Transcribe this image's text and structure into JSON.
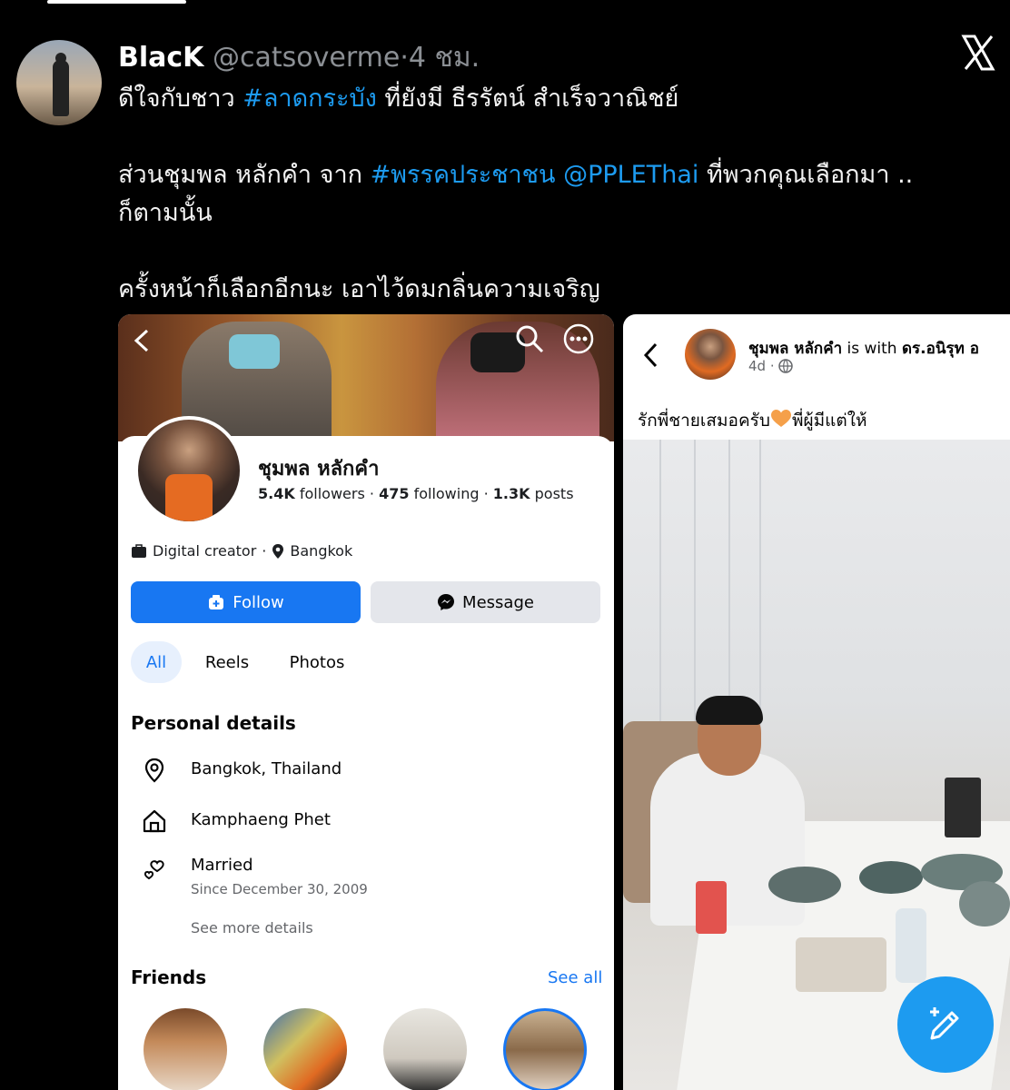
{
  "tweet": {
    "author_name": "BlacK",
    "author_handle": "@catsoverme",
    "separator": "·",
    "time": "4 ชม.",
    "line1_pre": "ดีใจกับชาว ",
    "line1_tag": "#ลาดกระบัง",
    "line1_post": " ที่ยังมี ธีรรัตน์ สำเร็จวาณิชย์",
    "line2_pre": "ส่วนชุมพล หลักคำ จาก ",
    "line2_tag": "#พรรคประชาชน",
    "line2_mention": "@PPLEThai",
    "line2_post": " ที่พวกคุณเลือกมา ..",
    "line3": "ก็ตามนั้น",
    "line4": "ครั้งหน้าก็เลือกอีกนะ เอาไว้ดมกลิ่นความเจริญ"
  },
  "profile_card": {
    "name": "ชุมพล หลักคำ",
    "followers_count": "5.4K",
    "followers_label": "followers",
    "following_count": "475",
    "following_label": "following",
    "posts_count": "1.3K",
    "posts_label": "posts",
    "dot": "·",
    "category": "Digital creator",
    "location": "Bangkok",
    "follow_label": "Follow",
    "message_label": "Message",
    "tabs": [
      "All",
      "Reels",
      "Photos"
    ],
    "personal_details_title": "Personal details",
    "current_city": "Bangkok, Thailand",
    "hometown": "Kamphaeng Phet",
    "relationship": "Married",
    "relationship_since": "Since December 30, 2009",
    "see_more_details": "See more details",
    "friends_title": "Friends",
    "see_all": "See all"
  },
  "post_card": {
    "author": "ชุมพล หลักคำ",
    "with_text": " is with ",
    "tagged": "ดร.อนิรุท อ",
    "age": "4d ·",
    "caption_pre": "รักพี่ชายเสมอครับ",
    "caption_post": "พี่ผู้มีแต่ให้"
  },
  "colors": {
    "link_blue": "#1d9bf0",
    "facebook_blue": "#1877f2",
    "heart_orange": "#f5a04a"
  },
  "icons": [
    "x-logo-icon",
    "back-arrow-icon",
    "search-icon",
    "more-icon",
    "briefcase-icon",
    "location-pin-icon",
    "follow-person-icon",
    "messenger-icon",
    "home-icon",
    "hearts-icon",
    "globe-icon",
    "compose-icon"
  ]
}
